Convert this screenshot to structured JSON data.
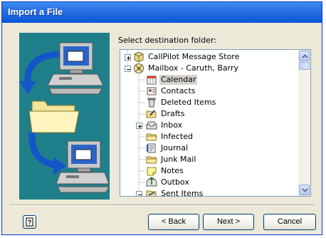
{
  "window": {
    "title": "Import a File"
  },
  "prompt": "Select destination folder:",
  "tree": {
    "items": [
      {
        "label": "CallPilot Message Store",
        "icon": "message-store-icon",
        "expander": "plus"
      },
      {
        "label": "Mailbox - Caruth, Barry",
        "icon": "mailbox-icon",
        "expander": "minus"
      },
      {
        "label": "Calendar",
        "icon": "calendar-icon",
        "selected": true
      },
      {
        "label": "Contacts",
        "icon": "contacts-icon"
      },
      {
        "label": "Deleted Items",
        "icon": "deleted-items-icon"
      },
      {
        "label": "Drafts",
        "icon": "drafts-icon"
      },
      {
        "label": "Inbox",
        "icon": "inbox-icon",
        "expander": "plus"
      },
      {
        "label": "Infected",
        "icon": "folder-icon"
      },
      {
        "label": "Journal",
        "icon": "journal-icon"
      },
      {
        "label": "Junk Mail",
        "icon": "folder-icon"
      },
      {
        "label": "Notes",
        "icon": "notes-icon"
      },
      {
        "label": "Outbox",
        "icon": "outbox-icon"
      },
      {
        "label": "Sent Items",
        "icon": "sent-items-icon",
        "expander": "minus"
      }
    ]
  },
  "buttons": {
    "help": "?",
    "back": "< Back",
    "next": "Next >",
    "cancel": "Cancel"
  },
  "colors": {
    "title_bar": "#0a57d7",
    "art_background": "#1f7f8a",
    "arrow": "#1356c9",
    "selection": "#d6d3ce"
  }
}
